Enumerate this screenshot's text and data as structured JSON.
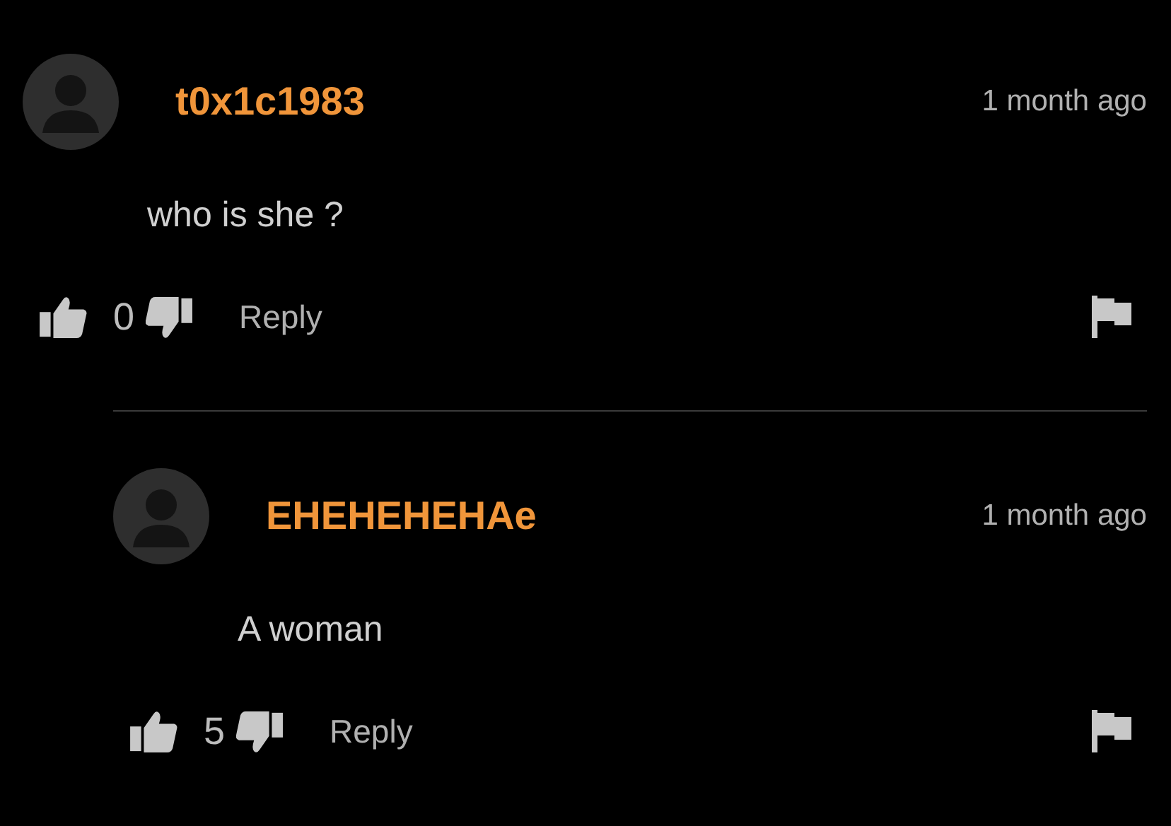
{
  "comments": [
    {
      "username": "t0x1c1983",
      "time": "1 month ago",
      "text": "who is she ?",
      "votes": "0",
      "reply_label": "Reply",
      "children": [
        {
          "username": "EHEHEHEHAe",
          "time": "1 month ago",
          "text": "A woman",
          "votes": "5",
          "reply_label": "Reply"
        }
      ]
    }
  ]
}
